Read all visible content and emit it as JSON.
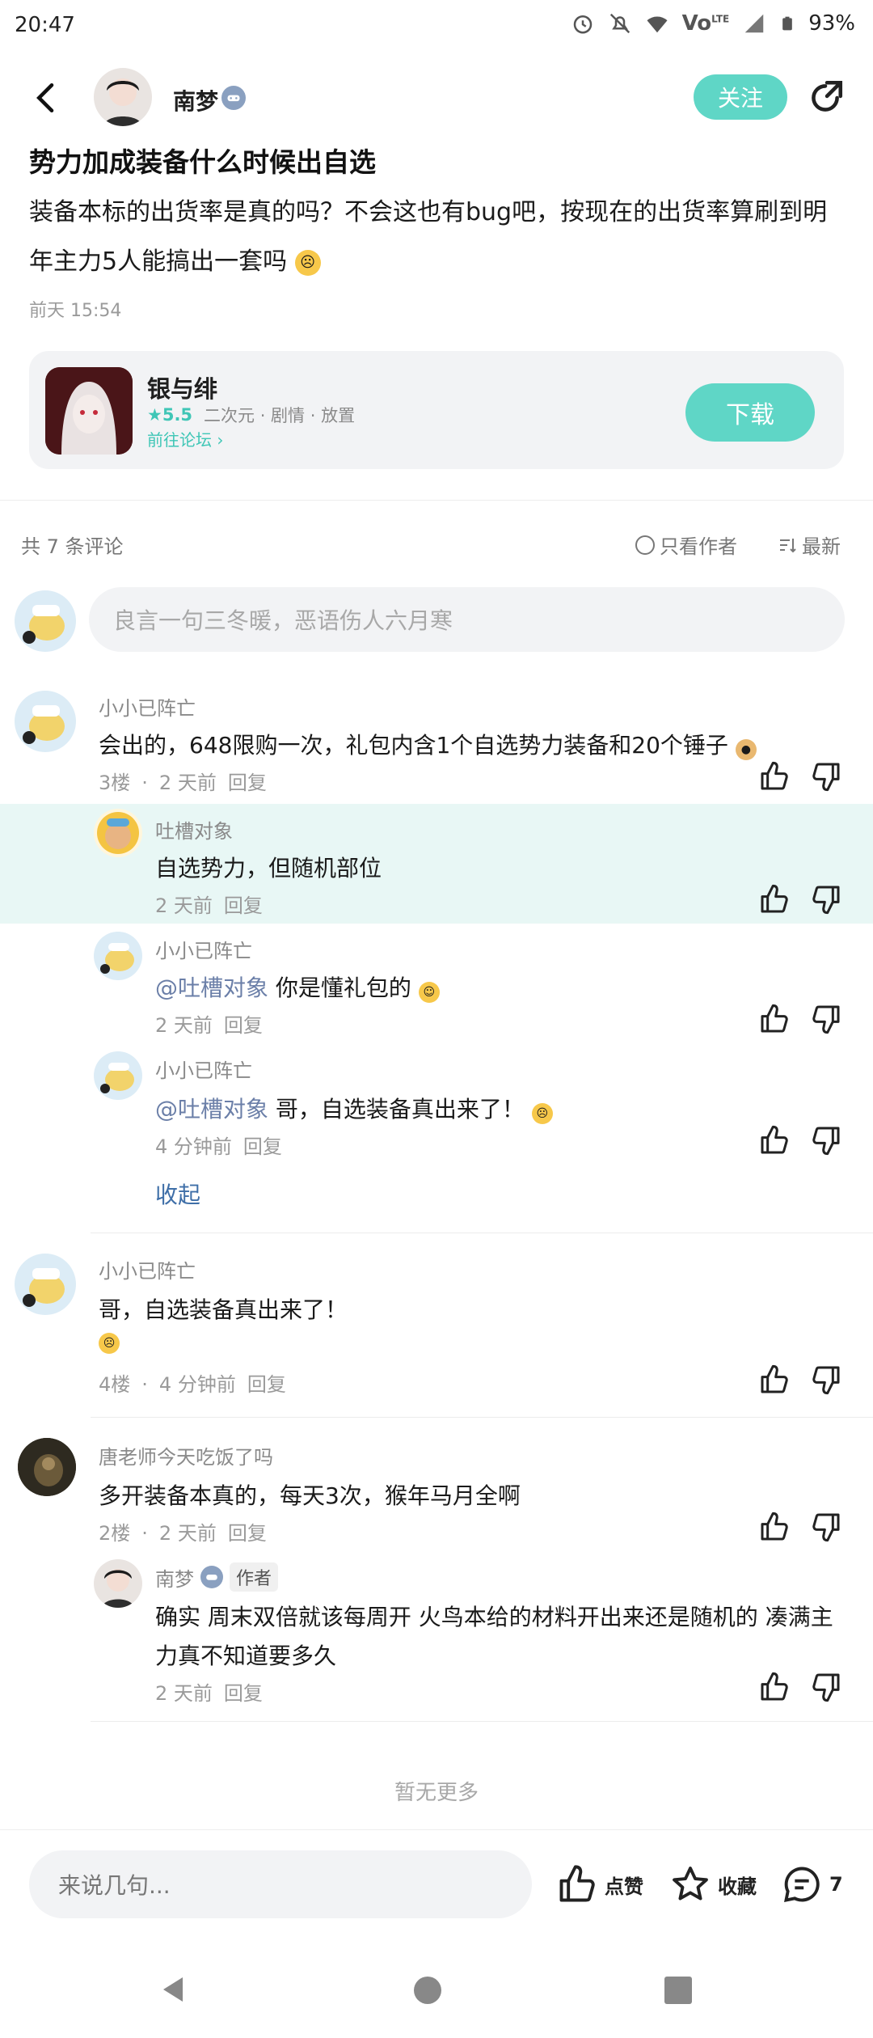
{
  "status": {
    "time": "20:47",
    "battery": "93%",
    "network": "Vo",
    "network_sup": "LTE"
  },
  "post": {
    "author": "南梦",
    "follow_label": "关注",
    "title": "势力加成装备什么时候出自选",
    "body": "装备本标的出货率是真的吗？不会这也有bug吧，按现在的出货率算刷到明年主力5人能搞出一套吗",
    "time": "前天 15:54"
  },
  "game_card": {
    "name": "银与绯",
    "rating": "5.5",
    "tags": "二次元 · 剧情 · 放置",
    "forum_link": "前往论坛",
    "download_label": "下载"
  },
  "comments_bar": {
    "count": "共 7 条评论",
    "only_author": "只看作者",
    "sort": "最新"
  },
  "comment_input": {
    "placeholder": "良言一句三冬暖，恶语伤人六月寒"
  },
  "comments": [
    {
      "name": "小小已阵亡",
      "text": "会出的，648限购一次，礼包内含1个自选势力装备和20个锤子",
      "floor": "3楼",
      "time": "2 天前",
      "reply": "回复",
      "replies": [
        {
          "name": "吐槽对象",
          "text": "自选势力，但随机部位",
          "time": "2 天前",
          "reply": "回复"
        },
        {
          "name": "小小已阵亡",
          "mention": "@吐槽对象",
          "text": "你是懂礼包的",
          "time": "2 天前",
          "reply": "回复"
        },
        {
          "name": "小小已阵亡",
          "mention": "@吐槽对象",
          "text": "哥，自选装备真出来了！",
          "time": "4 分钟前",
          "reply": "回复"
        }
      ],
      "collapse": "收起"
    },
    {
      "name": "小小已阵亡",
      "text": "哥，自选装备真出来了！",
      "floor": "4楼",
      "time": "4 分钟前",
      "reply": "回复"
    },
    {
      "name": "唐老师今天吃饭了吗",
      "text": "多开装备本真的，每天3次，猴年马月全啊",
      "floor": "2楼",
      "time": "2 天前",
      "reply": "回复",
      "replies": [
        {
          "name": "南梦",
          "author_tag": "作者",
          "text": "确实 周末双倍就该每周开 火鸟本给的材料开出来还是随机的 凑满主力真不知道要多久",
          "time": "2 天前",
          "reply": "回复"
        }
      ]
    }
  ],
  "no_more": "暂无更多",
  "bottom_bar": {
    "input_placeholder": "来说几句...",
    "like": "点赞",
    "favorite": "收藏",
    "comment_count": "7"
  },
  "colors": {
    "accent": "#5fd6c6",
    "highlight": "#e8f7f5",
    "mention": "#6b7fa8"
  }
}
